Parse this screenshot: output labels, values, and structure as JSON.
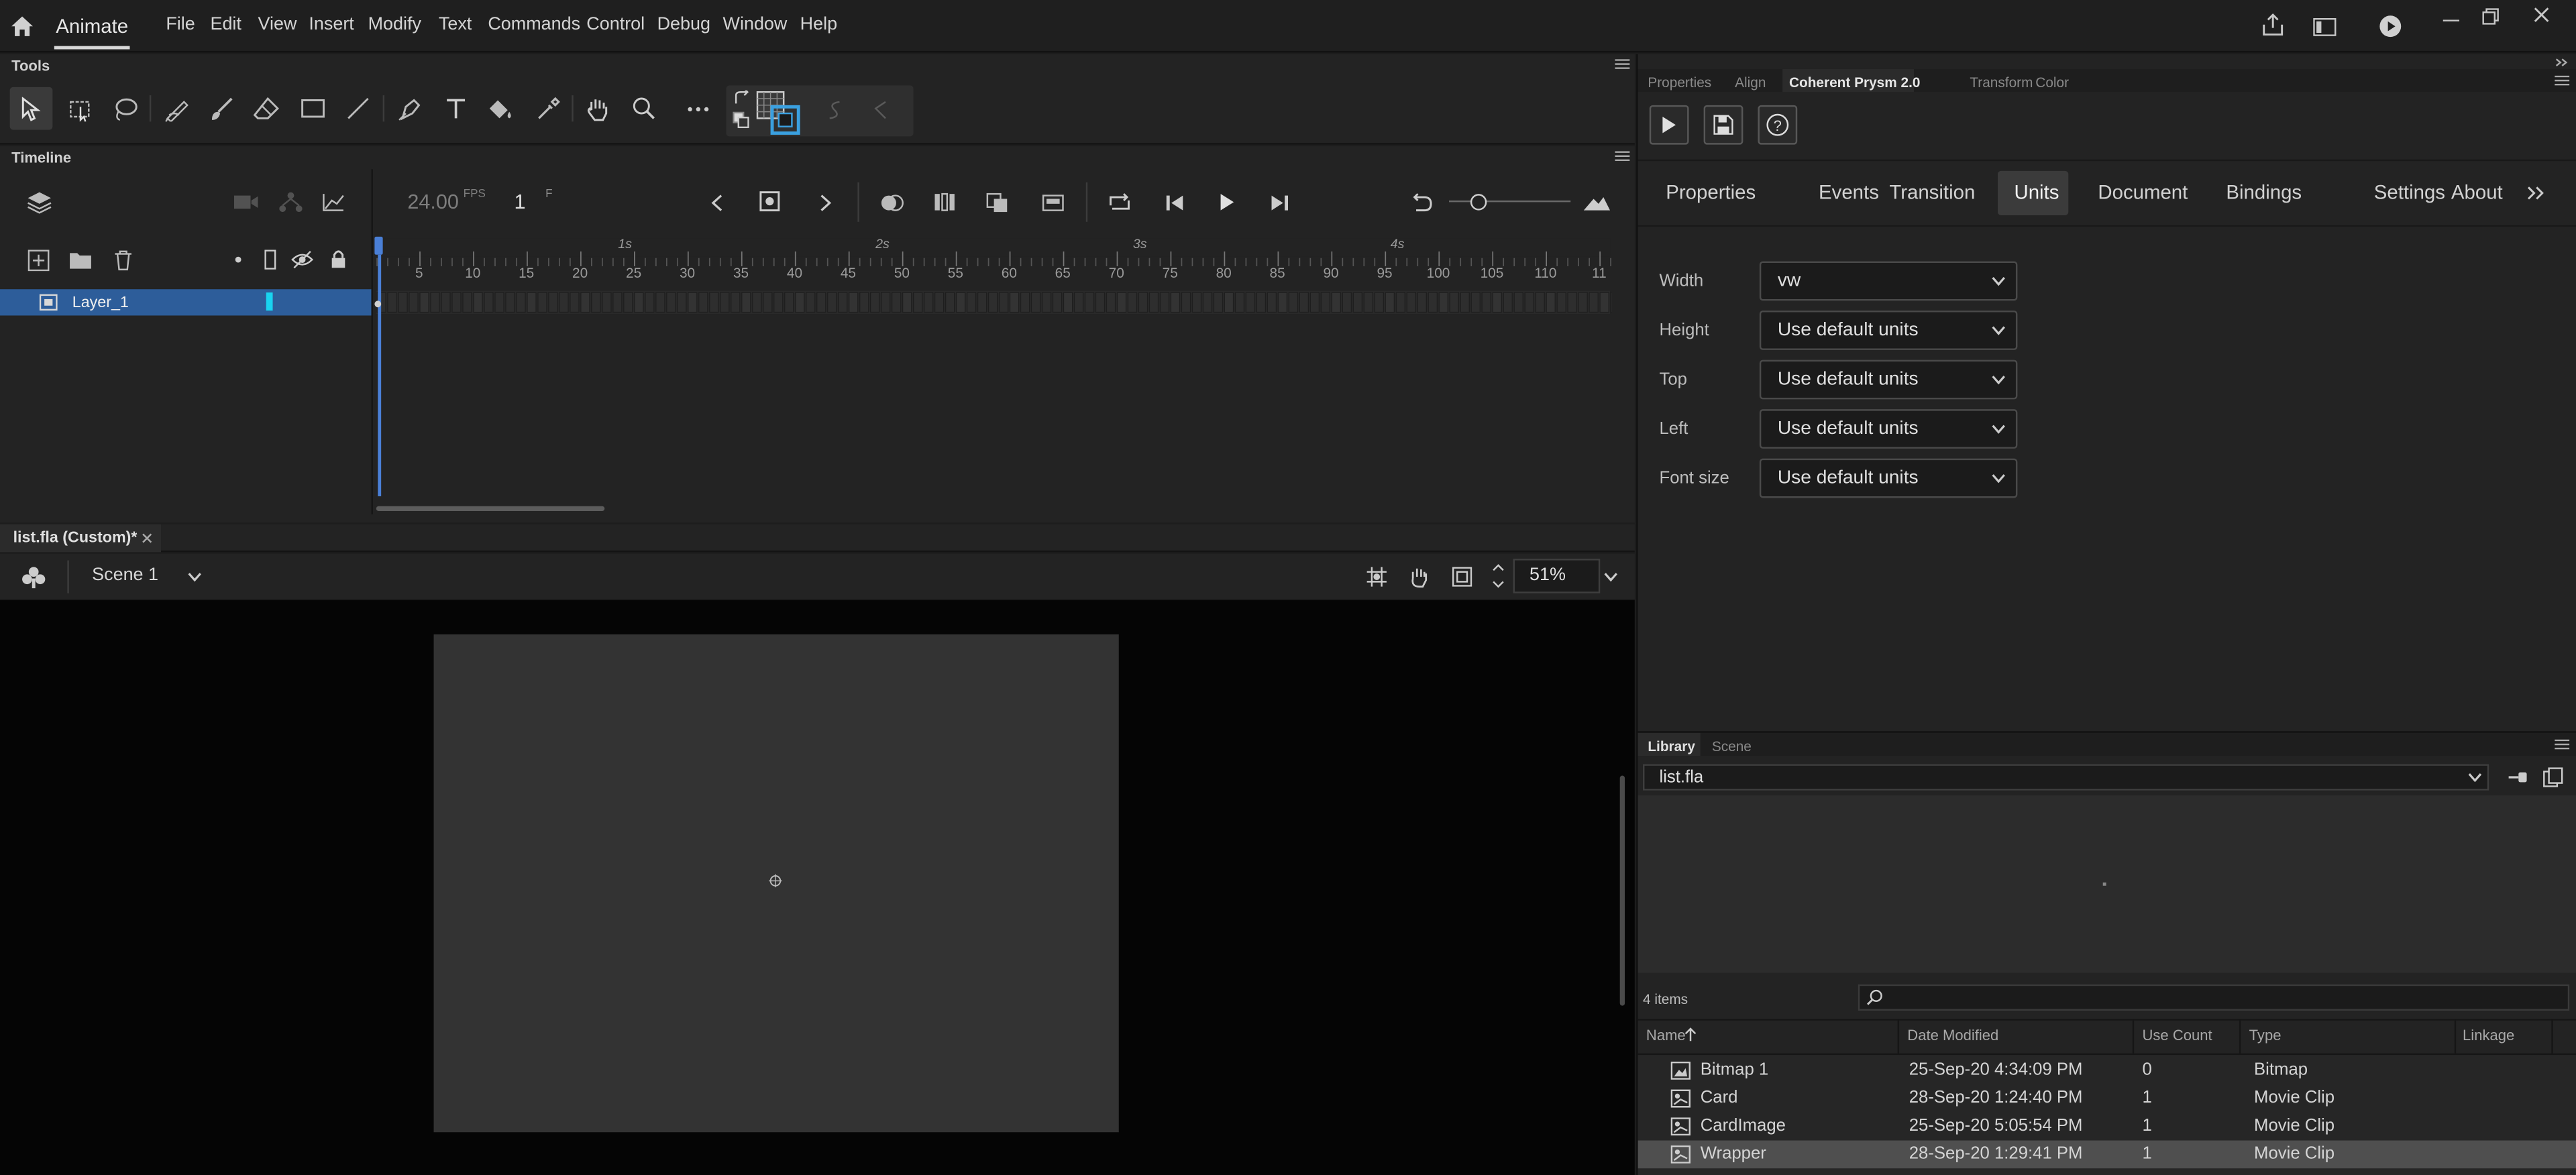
{
  "app": {
    "name": "Animate"
  },
  "menu": [
    "File",
    "Edit",
    "View",
    "Insert",
    "Modify",
    "Text",
    "Commands",
    "Control",
    "Debug",
    "Window",
    "Help"
  ],
  "tools_panel": {
    "title": "Tools"
  },
  "timeline": {
    "title": "Timeline",
    "fps": "24.00",
    "fps_unit": "FPS",
    "frame": "1",
    "frame_unit": "F",
    "seconds": [
      "1s",
      "2s",
      "3s",
      "4s"
    ],
    "ticks": [
      "5",
      "10",
      "15",
      "20",
      "25",
      "30",
      "35",
      "40",
      "45",
      "50",
      "55",
      "60",
      "65",
      "70",
      "75",
      "80",
      "85",
      "90",
      "95",
      "100",
      "105",
      "110",
      "11"
    ],
    "layers": [
      {
        "name": "Layer_1"
      }
    ]
  },
  "document": {
    "tab": "list.fla (Custom)*",
    "scene": "Scene 1",
    "zoom": "51%"
  },
  "right_tabs": [
    "Properties",
    "Align",
    "Coherent Prysm 2.0",
    "Transform",
    "Color"
  ],
  "prysm": {
    "tabs": [
      "Properties",
      "Events",
      "Transition",
      "Units",
      "Document",
      "Bindings",
      "Settings",
      "About"
    ],
    "active_tab": "Units",
    "fields": [
      {
        "label": "Width",
        "value": "vw"
      },
      {
        "label": "Height",
        "value": "Use default units"
      },
      {
        "label": "Top",
        "value": "Use default units"
      },
      {
        "label": "Left",
        "value": "Use default units"
      },
      {
        "label": "Font size",
        "value": "Use default units"
      }
    ]
  },
  "library": {
    "tabs": [
      "Library",
      "Scene"
    ],
    "file": "list.fla",
    "count": "4 items",
    "columns": [
      "Name",
      "Date Modified",
      "Use Count",
      "Type",
      "Linkage"
    ],
    "items": [
      {
        "name": "Bitmap 1",
        "date": "25-Sep-20 4:34:09 PM",
        "count": "0",
        "type": "Bitmap"
      },
      {
        "name": "Card",
        "date": "28-Sep-20 1:24:40 PM",
        "count": "1",
        "type": "Movie Clip"
      },
      {
        "name": "CardImage",
        "date": "25-Sep-20 5:05:54 PM",
        "count": "1",
        "type": "Movie Clip"
      },
      {
        "name": "Wrapper",
        "date": "28-Sep-20 1:29:41 PM",
        "count": "1",
        "type": "Movie Clip"
      }
    ]
  },
  "colors": {
    "accent": "#2d5d9a",
    "selection": "#4f4f4f",
    "playhead": "#4a7fd6"
  }
}
